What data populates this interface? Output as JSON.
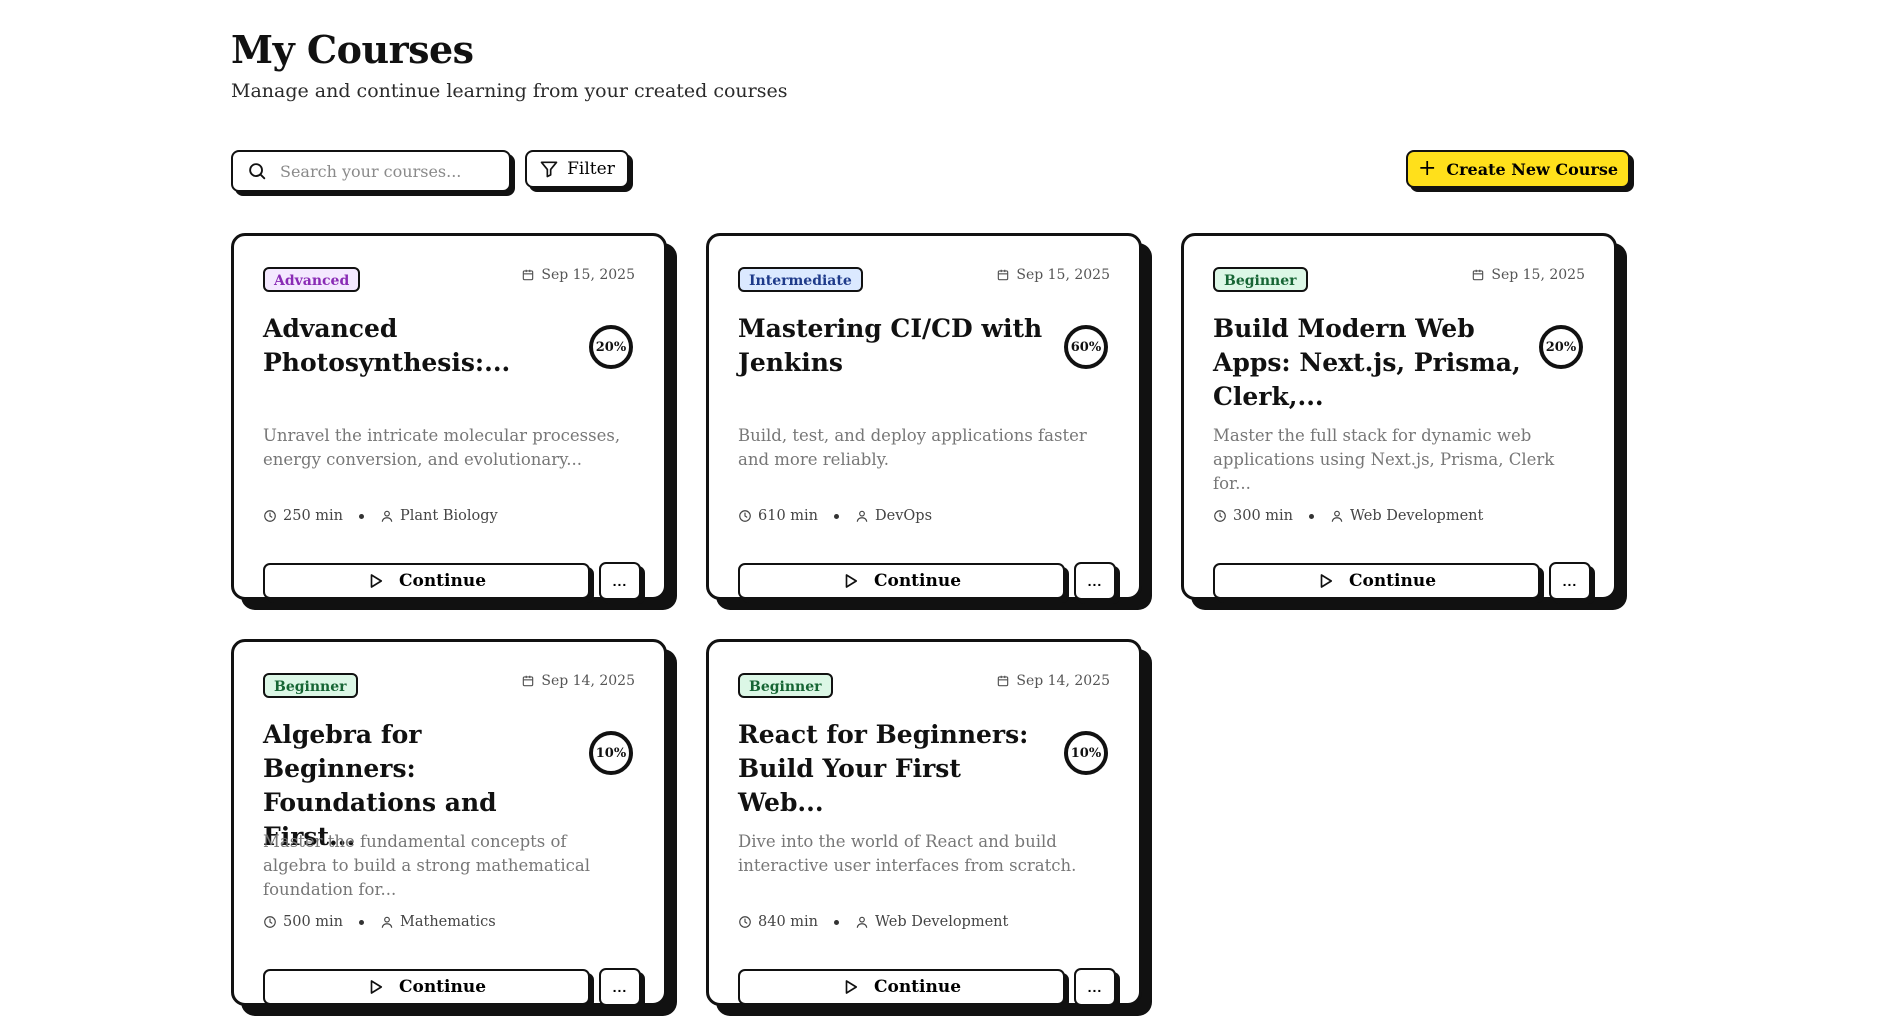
{
  "header": {
    "title": "My Courses",
    "subtitle": "Manage and continue learning from your created courses"
  },
  "toolbar": {
    "search_placeholder": "Search your courses...",
    "filter_label": "Filter",
    "create_label": "Create New Course",
    "accent_color": "#ffe01b"
  },
  "courses": [
    {
      "level": "Advanced",
      "date": "Sep 15, 2025",
      "title": "Advanced Photosynthesis:...",
      "progress": "20%",
      "description": "Unravel the intricate molecular processes, energy conversion, and evolutionary...",
      "duration": "250 min",
      "category": "Plant Biology",
      "continue_label": "Continue",
      "more_label": "..."
    },
    {
      "level": "Intermediate",
      "date": "Sep 15, 2025",
      "title": "Mastering CI/CD with Jenkins",
      "progress": "60%",
      "description": "Build, test, and deploy applications faster and more reliably.",
      "duration": "610 min",
      "category": "DevOps",
      "continue_label": "Continue",
      "more_label": "..."
    },
    {
      "level": "Beginner",
      "date": "Sep 15, 2025",
      "title": "Build Modern Web Apps: Next.js, Prisma, Clerk,...",
      "progress": "20%",
      "description": "Master the full stack for dynamic web applications using Next.js, Prisma, Clerk for...",
      "duration": "300 min",
      "category": "Web Development",
      "continue_label": "Continue",
      "more_label": "..."
    },
    {
      "level": "Beginner",
      "date": "Sep 14, 2025",
      "title": "Algebra for Beginners: Foundations and First...",
      "progress": "10%",
      "description": "Master the fundamental concepts of algebra to build a strong mathematical foundation for...",
      "duration": "500 min",
      "category": "Mathematics",
      "continue_label": "Continue",
      "more_label": "..."
    },
    {
      "level": "Beginner",
      "date": "Sep 14, 2025",
      "title": "React for Beginners: Build Your First Web...",
      "progress": "10%",
      "description": "Dive into the world of React and build interactive user interfaces from scratch.",
      "duration": "840 min",
      "category": "Web Development",
      "continue_label": "Continue",
      "more_label": "..."
    }
  ]
}
